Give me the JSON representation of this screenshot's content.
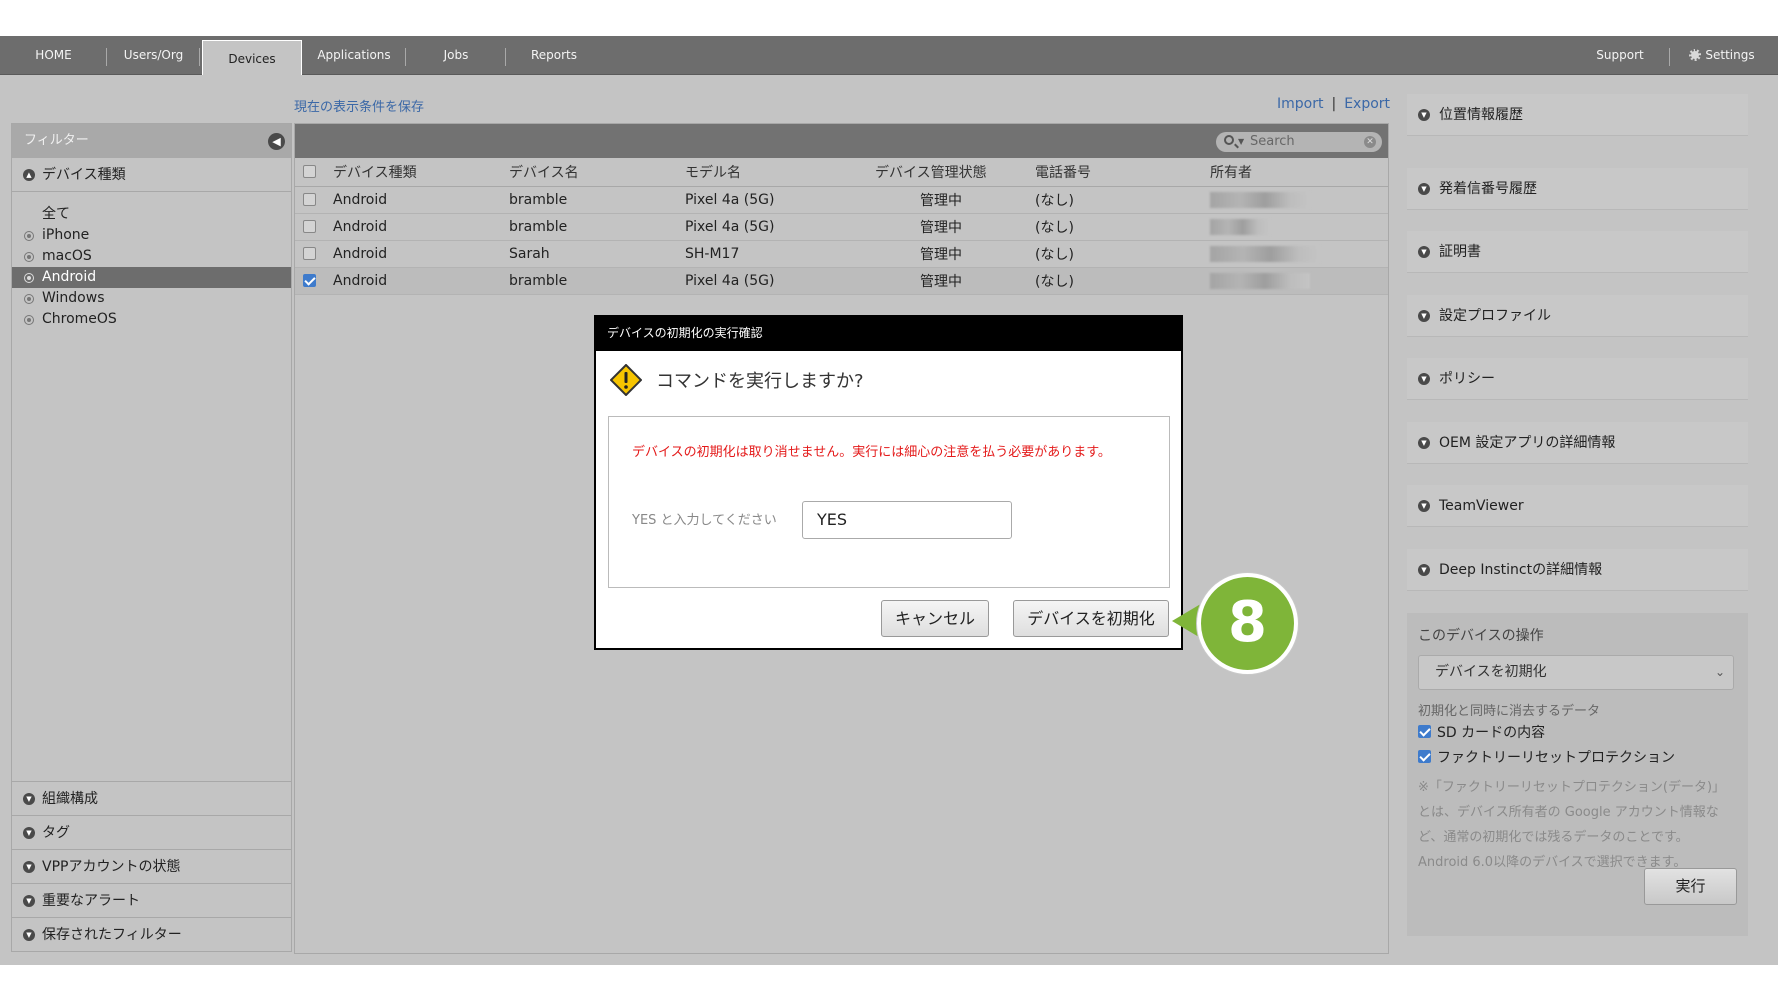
{
  "nav": {
    "tabs": [
      "HOME",
      "Users/Org",
      "Devices",
      "Applications",
      "Jobs",
      "Reports"
    ],
    "active": "Devices",
    "support": "Support",
    "settings": "Settings"
  },
  "links": {
    "save_view": "現在の表示条件を保存",
    "import": "Import",
    "sep": "|",
    "export": "Export"
  },
  "sidebar": {
    "filter_title": "フィルター",
    "device_type_header": "デバイス種類",
    "items": [
      "全て",
      "iPhone",
      "macOS",
      "Android",
      "Windows",
      "ChromeOS"
    ],
    "selected": "Android",
    "bottom_sections": [
      "組織構成",
      "タグ",
      "VPPアカウントの状態",
      "重要なアラート",
      "保存されたフィルター"
    ]
  },
  "grid": {
    "search_placeholder": "Search",
    "headers": [
      "デバイス種類",
      "デバイス名",
      "モデル名",
      "デバイス管理状態",
      "電話番号",
      "所有者"
    ],
    "rows": [
      {
        "type": "Android",
        "name": "bramble",
        "model": "Pixel 4a (5G)",
        "status": "管理中",
        "phone": "(なし)",
        "checked": false
      },
      {
        "type": "Android",
        "name": "bramble",
        "model": "Pixel 4a (5G)",
        "status": "管理中",
        "phone": "(なし)",
        "checked": false
      },
      {
        "type": "Android",
        "name": "Sarah",
        "model": "SH-M17",
        "status": "管理中",
        "phone": "(なし)",
        "checked": false
      },
      {
        "type": "Android",
        "name": "bramble",
        "model": "Pixel 4a (5G)",
        "status": "管理中",
        "phone": "(なし)",
        "checked": true
      }
    ]
  },
  "right_panel": {
    "sections": [
      "位置情報履歴",
      "発着信番号履歴",
      "証明書",
      "設定プロファイル",
      "ポリシー",
      "OEM 設定アプリの詳細情報",
      "TeamViewer",
      "Deep Instinctの詳細情報"
    ],
    "ops_title": "このデバイスの操作",
    "ops_select": "デバイスを初期化",
    "ops_sub": "初期化と同時に消去するデータ",
    "ops_checks": [
      "SD カードの内容",
      "ファクトリーリセットプロテクション"
    ],
    "ops_note": "※「ファクトリーリセットプロテクション(データ)」とは、デバイス所有者の Google アカウント情報など、通常の初期化では残るデータのことです。Android 6.0以降のデバイスで選択できます。",
    "run_button": "実行"
  },
  "modal": {
    "title": "デバイスの初期化の実行確認",
    "question": "コマンドを実行しますか?",
    "warning": "デバイスの初期化は取り消せません。実行には細心の注意を払う必要があります。",
    "input_label": "YES と入力してください",
    "input_value": "YES",
    "cancel": "キャンセル",
    "confirm": "デバイスを初期化"
  },
  "step_badge": "8"
}
